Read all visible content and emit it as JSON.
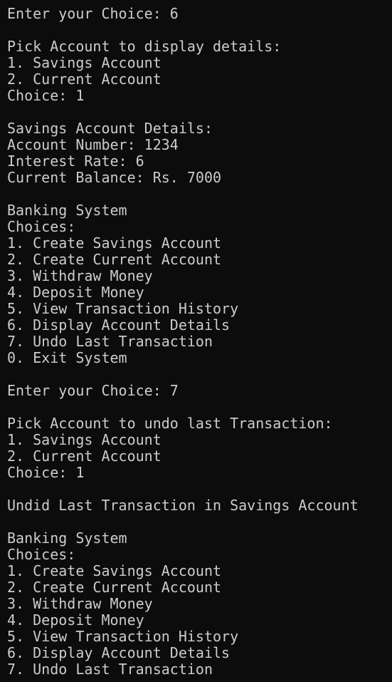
{
  "terminal": {
    "lines": [
      "Enter your Choice: 6",
      "",
      "Pick Account to display details:",
      "1. Savings Account",
      "2. Current Account",
      "Choice: 1",
      "",
      "Savings Account Details:",
      "Account Number: 1234",
      "Interest Rate: 6",
      "Current Balance: Rs. 7000",
      "",
      "Banking System",
      "Choices:",
      "1. Create Savings Account",
      "2. Create Current Account",
      "3. Withdraw Money",
      "4. Deposit Money",
      "5. View Transaction History",
      "6. Display Account Details",
      "7. Undo Last Transaction",
      "0. Exit System",
      "",
      "Enter your Choice: 7",
      "",
      "Pick Account to undo last Transaction:",
      "1. Savings Account",
      "2. Current Account",
      "Choice: 1",
      "",
      "Undid Last Transaction in Savings Account",
      "",
      "Banking System",
      "Choices:",
      "1. Create Savings Account",
      "2. Create Current Account",
      "3. Withdraw Money",
      "4. Deposit Money",
      "5. View Transaction History",
      "6. Display Account Details",
      "7. Undo Last Transaction"
    ]
  }
}
